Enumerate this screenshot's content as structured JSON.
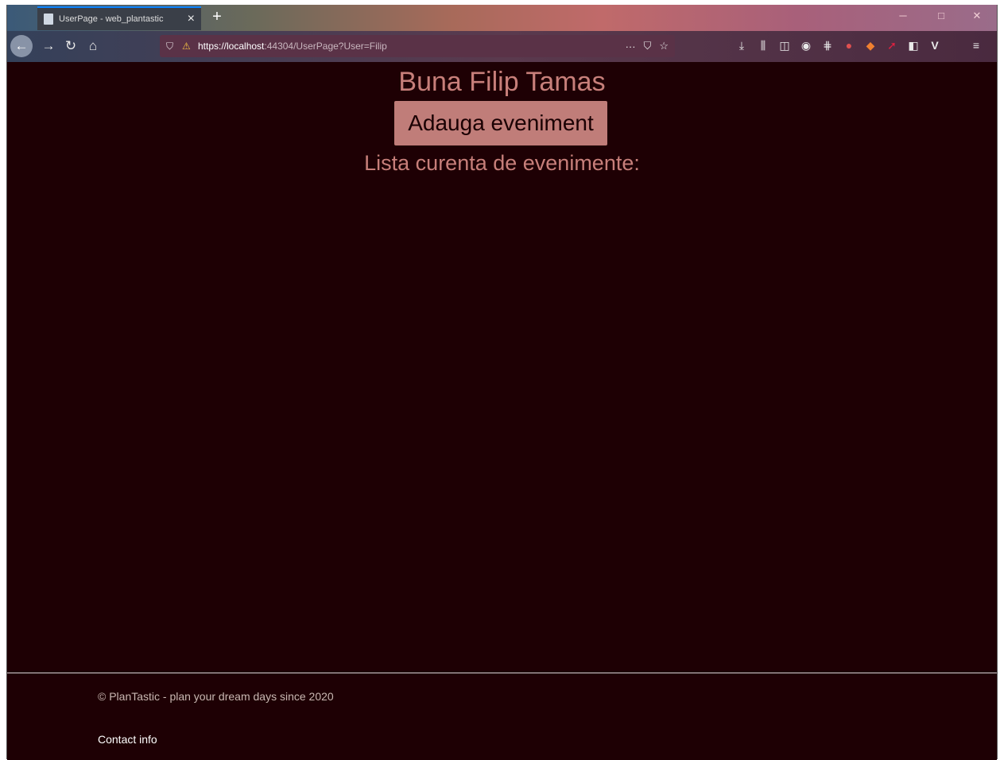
{
  "browser": {
    "tab_title": "UserPage - web_plantastic",
    "close_tab_glyph": "×",
    "new_tab_glyph": "+",
    "url_host": "https://localhost",
    "url_rest": ":44304/UserPage?User=Filip",
    "page_actions_glyph": "···",
    "window_controls": {
      "minimize": "─",
      "maximize": "□",
      "close": "✕"
    },
    "toolbar_icons": [
      "download-icon",
      "library-icon",
      "sidebar-icon",
      "account-icon",
      "extension-icon",
      "extension-icon",
      "extension-icon",
      "extension-icon",
      "extension-icon",
      "extension-icon",
      "menu-icon"
    ]
  },
  "page": {
    "greeting": "Buna Filip Tamas",
    "add_event_button": "Adauga eveniment",
    "list_title": "Lista curenta de evenimente:",
    "events": []
  },
  "footer": {
    "copyright": "© PlanTastic - plan your dream days since 2020",
    "contact": "Contact info"
  },
  "colors": {
    "page_background": "#1e0004",
    "accent": "#c77f7a",
    "button_background": "#c07d79"
  }
}
